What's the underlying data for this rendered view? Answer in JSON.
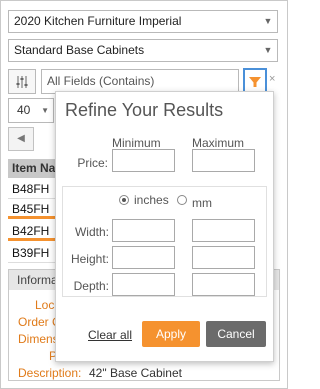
{
  "catalog_select": {
    "value": "2020 Kitchen Furniture Imperial"
  },
  "category_select": {
    "value": "Standard Base Cabinets"
  },
  "search": {
    "placeholder": "All Fields (Contains)",
    "close_glyph": "×"
  },
  "page_size": {
    "value": "40"
  },
  "pager": {
    "prev_glyph": "◀"
  },
  "grid": {
    "header": "Item Name",
    "rows": [
      {
        "name": "B48FH",
        "marked": false
      },
      {
        "name": "B45FH",
        "marked": true
      },
      {
        "name": "B42FH",
        "marked": true
      },
      {
        "name": "B39FH",
        "marked": false
      }
    ]
  },
  "info": {
    "header": "Information",
    "fields": [
      {
        "label": "Location:",
        "value": ""
      },
      {
        "label": "Order Code:",
        "value": ""
      },
      {
        "label": "Dimensions:",
        "value": ""
      },
      {
        "label": "Price:",
        "value": ""
      },
      {
        "label": "Description:",
        "value": "42\" Base Cabinet"
      }
    ]
  },
  "refine": {
    "title": "Refine Your Results",
    "min_label": "Minimum",
    "max_label": "Maximum",
    "price_label": "Price:",
    "units": [
      {
        "label": "inches",
        "selected": true
      },
      {
        "label": "mm",
        "selected": false
      }
    ],
    "width_label": "Width:",
    "height_label": "Height:",
    "depth_label": "Depth:",
    "clear_label": "Clear all",
    "apply_label": "Apply",
    "cancel_label": "Cancel"
  },
  "colors": {
    "accent": "#f5922f",
    "focus_border": "#4a90d9",
    "cancel": "#6b6b6b",
    "label_orange": "#e07b1a"
  }
}
